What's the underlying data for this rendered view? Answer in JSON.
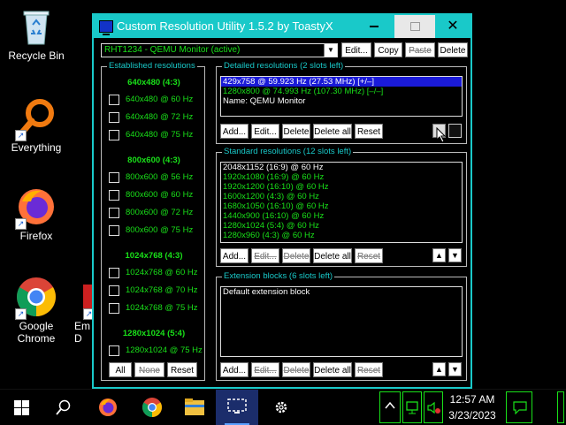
{
  "desktop": {
    "icons": [
      {
        "label": "Recycle Bin"
      },
      {
        "label": "Everything"
      },
      {
        "label": "Firefox"
      },
      {
        "label": "Google Chrome"
      },
      {
        "label": "Em\nD"
      }
    ]
  },
  "window": {
    "title": "Custom Resolution Utility 1.5.2 by ToastyX",
    "monitor": "RHT1234 - QEMU Monitor (active)",
    "top_buttons": [
      "Edit...",
      "Copy",
      "Paste",
      "Delete"
    ],
    "established": {
      "title": "Established resolutions",
      "groups": [
        {
          "head": "640x480 (4:3)",
          "items": [
            "640x480 @ 60 Hz",
            "640x480 @ 72 Hz",
            "640x480 @ 75 Hz"
          ]
        },
        {
          "head": "800x600 (4:3)",
          "items": [
            "800x600 @ 56 Hz",
            "800x600 @ 60 Hz",
            "800x600 @ 72 Hz",
            "800x600 @ 75 Hz"
          ]
        },
        {
          "head": "1024x768 (4:3)",
          "items": [
            "1024x768 @ 60 Hz",
            "1024x768 @ 70 Hz",
            "1024x768 @ 75 Hz"
          ]
        },
        {
          "head": "1280x1024 (5:4)",
          "items": [
            "1280x1024 @ 75 Hz"
          ]
        }
      ],
      "buttons": [
        "All",
        "None",
        "Reset"
      ]
    },
    "detailed": {
      "title": "Detailed resolutions (2 slots left)",
      "items": [
        "429x758 @ 59.923 Hz (27.53 MHz) [+/–]",
        "1280x800 @ 74.993 Hz (107.30 MHz) [–/–]",
        "Name: QEMU Monitor"
      ],
      "buttons": [
        "Add...",
        "Edit...",
        "Delete",
        "Delete all",
        "Reset"
      ]
    },
    "standard": {
      "title": "Standard resolutions (12 slots left)",
      "items": [
        "2048x1152 (16:9) @ 60 Hz",
        "1920x1080 (16:9) @ 60 Hz",
        "1920x1200 (16:10) @ 60 Hz",
        "1600x1200 (4:3) @ 60 Hz",
        "1680x1050 (16:10) @ 60 Hz",
        "1440x900 (16:10) @ 60 Hz",
        "1280x1024 (5:4) @ 60 Hz",
        "1280x960 (4:3) @ 60 Hz"
      ],
      "buttons": [
        "Add...",
        "Edit...",
        "Delete",
        "Delete all",
        "Reset"
      ]
    },
    "extension": {
      "title": "Extension blocks (6 slots left)",
      "items": [
        "Default extension block"
      ],
      "buttons": [
        "Add...",
        "Edit...",
        "Delete",
        "Delete all",
        "Reset"
      ]
    }
  },
  "taskbar": {
    "time": "12:57 AM",
    "date": "3/23/2023"
  },
  "colors": {
    "accent": "#19c9c9",
    "text_green": "#19e019",
    "selection": "#1a1ad8"
  }
}
